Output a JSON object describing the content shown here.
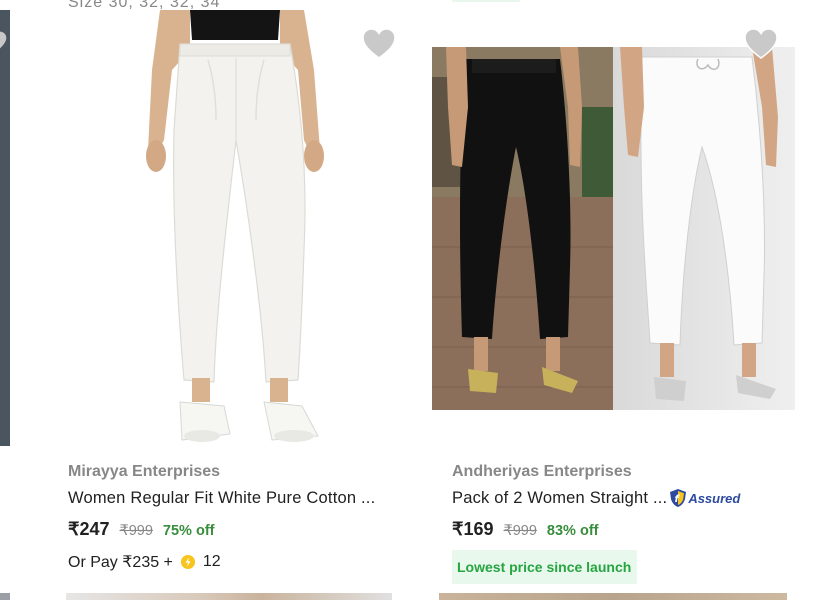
{
  "top_cut_text": "Size 30, 32, 32, 34",
  "products": [
    {
      "brand": "Mirayya Enterprises",
      "title": "Women Regular Fit White Pure Cotton ...",
      "price": "₹247",
      "mrp": "₹999",
      "discount": "75% off",
      "pay_prefix": "Or Pay ₹235 +",
      "coins": "12",
      "wishlist_icon": "heart-icon"
    },
    {
      "brand": "Andheriyas Enterprises",
      "title": "Pack of 2 Women Straight ...",
      "assured_label": "Assured",
      "price": "₹169",
      "mrp": "₹999",
      "discount": "83% off",
      "badge": "Lowest price since launch",
      "wishlist_icon": "heart-icon"
    }
  ],
  "colors": {
    "brand_text": "#878787",
    "discount_green": "#388e3c",
    "badge_bg": "#e8f8ec",
    "badge_text": "#26a541",
    "assured_blue": "#2b4aa0",
    "coin_yellow": "#f7c51e"
  }
}
